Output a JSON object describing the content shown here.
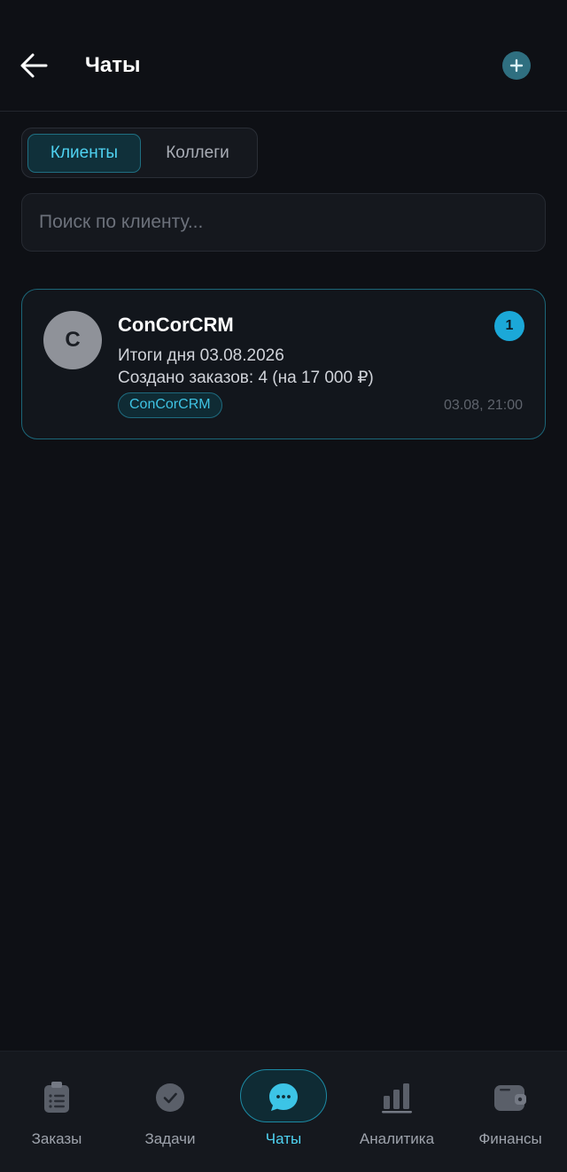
{
  "header": {
    "title": "Чаты",
    "back_icon": "arrow-left-icon",
    "add_icon": "plus-icon"
  },
  "tabs": [
    {
      "label": "Клиенты",
      "active": true
    },
    {
      "label": "Коллеги",
      "active": false
    }
  ],
  "search": {
    "placeholder": "Поиск по клиенту...",
    "value": ""
  },
  "chats": [
    {
      "avatar_letter": "C",
      "name": "ConCorCRM",
      "line1": "Итоги дня 03.08.2026",
      "line2": "Создано заказов: 4 (на 17 000 ₽)",
      "tag": "ConCorCRM",
      "unread": "1",
      "time": "03.08, 21:00"
    }
  ],
  "nav": [
    {
      "label": "Заказы",
      "icon": "clipboard-icon",
      "active": false
    },
    {
      "label": "Задачи",
      "icon": "check-circle-icon",
      "active": false
    },
    {
      "label": "Чаты",
      "icon": "chat-bubble-icon",
      "active": true
    },
    {
      "label": "Аналитика",
      "icon": "bar-chart-icon",
      "active": false
    },
    {
      "label": "Финансы",
      "icon": "wallet-icon",
      "active": false
    }
  ],
  "colors": {
    "background": "#0e1015",
    "accent": "#4fd3f2",
    "badge": "#1ba8d8"
  }
}
